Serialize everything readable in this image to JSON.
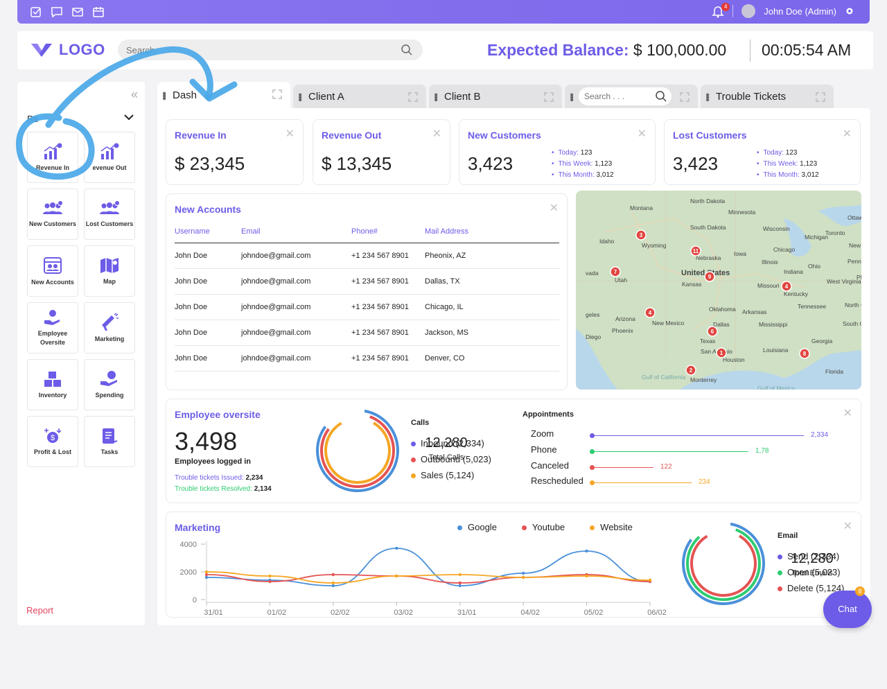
{
  "topbar": {
    "icons": [
      "checkbox-icon",
      "chat-icon",
      "mail-icon",
      "calendar-icon"
    ],
    "notification_count": "4",
    "user": "John Doe (Admin)"
  },
  "header": {
    "logo": "LOGO",
    "search_placeholder": "Search",
    "balance_label": "Expected Balance:",
    "balance_value": "$ 100,000.00",
    "clock": "00:05:54 AM"
  },
  "sidebar": {
    "section": "Re",
    "tiles": [
      {
        "label": "Revenue In",
        "icon": "revenue-in-icon"
      },
      {
        "label": "evenue Out",
        "icon": "revenue-out-icon"
      },
      {
        "label": "New Customers",
        "icon": "new-customers-icon"
      },
      {
        "label": "Lost Customers",
        "icon": "lost-customers-icon"
      },
      {
        "label": "New Accounts",
        "icon": "new-accounts-icon"
      },
      {
        "label": "Map",
        "icon": "map-icon"
      },
      {
        "label": "Employee Oversite",
        "icon": "employee-oversite-icon"
      },
      {
        "label": "Marketing",
        "icon": "marketing-icon"
      },
      {
        "label": "Inventory",
        "icon": "inventory-icon"
      },
      {
        "label": "Spending",
        "icon": "spending-icon"
      },
      {
        "label": "Profit & Lost",
        "icon": "profit-lost-icon"
      },
      {
        "label": "Tasks",
        "icon": "tasks-icon"
      }
    ],
    "report": "Report"
  },
  "tabs": [
    {
      "label": "Dash"
    },
    {
      "label": "Client A"
    },
    {
      "label": "Client B"
    },
    {
      "label": "",
      "placeholder": "Search . . ."
    },
    {
      "label": "Trouble Tickets"
    }
  ],
  "kpis": [
    {
      "title": "Revenue In",
      "value": "$ 23,345"
    },
    {
      "title": "Revenue Out",
      "value": "$ 13,345"
    },
    {
      "title": "New Customers",
      "value": "3,423",
      "stats": [
        [
          "Today:",
          "123"
        ],
        [
          "This Week:",
          "1,123"
        ],
        [
          "This Month:",
          "3,012"
        ]
      ]
    },
    {
      "title": "Lost Customers",
      "value": "3,423",
      "stats": [
        [
          "Today:",
          "123"
        ],
        [
          "This Week:",
          "1,123"
        ],
        [
          "This Month:",
          "3,012"
        ]
      ]
    }
  ],
  "accounts": {
    "title": "New Accounts",
    "columns": [
      "Username",
      "Email",
      "Phone#",
      "Mail Address"
    ],
    "rows": [
      [
        "John Doe",
        "johndoe@gmail.com",
        "+1 234 567 8901",
        "Pheonix, AZ"
      ],
      [
        "John Doe",
        "johndoe@gmail.com",
        "+1 234 567 8901",
        "Dallas, TX"
      ],
      [
        "John Doe",
        "johndoe@gmail.com",
        "+1 234 567 8901",
        "Chicago, IL"
      ],
      [
        "John Doe",
        "johndoe@gmail.com",
        "+1 234 567 8901",
        "Jackson, MS"
      ],
      [
        "John Doe",
        "johndoe@gmail.com",
        "+1 234 567 8901",
        "Denver, CO"
      ]
    ]
  },
  "map": {
    "state_labels": [
      "Montana",
      "North Dakota",
      "Minnesota",
      "South Dakota",
      "Wisconsin",
      "Michigan",
      "Ottawa",
      "Toronto",
      "New York",
      "Idaho",
      "Wyoming",
      "Nebraska",
      "Iowa",
      "Chicago",
      "Illinois",
      "Ohio",
      "Pennsylvania",
      "Philadel",
      "vada",
      "Utah",
      "United States",
      "Kansas",
      "Missouri",
      "Indiana",
      "West Virginia",
      "Kentucky",
      "Tennessee",
      "North Carolina",
      "South Carolina",
      "Oklahoma",
      "Arkansas",
      "Mississippi",
      "Georgia",
      "Arizona",
      "New Mexico",
      "Dallas",
      "Texas",
      "Phoenix",
      "geles",
      "Diego",
      "San Antonio",
      "Houston",
      "Louisiana",
      "Florida",
      "Gulf of California",
      "Monterrey",
      "Gulf of Mexico"
    ],
    "markers": [
      "3",
      "11",
      "7",
      "9",
      "4",
      "4",
      "6",
      "1",
      "2",
      "8"
    ]
  },
  "employee": {
    "title": "Employee oversite",
    "value": "3,498",
    "subtitle": "Employees logged in",
    "issued_label": "Trouble tickets Issued:",
    "issued_value": "2,234",
    "resolved_label": "Trouble tickets Resolved:",
    "resolved_value": "2,134",
    "calls_total": "12,280",
    "calls_total_label": "Total Calls",
    "calls_heading": "Calls",
    "calls": [
      {
        "label": "Inbound (2,334)",
        "color": "#6c5ce7"
      },
      {
        "label": "Outbound (5,023)",
        "color": "#e55353"
      },
      {
        "label": "Sales (5,124)",
        "color": "#f5a623"
      }
    ],
    "appointments_heading": "Appointments",
    "appointments": [
      {
        "label": "Zoom",
        "value": "2,334",
        "color": "#6c5ce7",
        "fraction": 1.0
      },
      {
        "label": "Phone",
        "value": "1,78",
        "color": "#2ecc71",
        "fraction": 0.74
      },
      {
        "label": "Canceled",
        "value": "122",
        "color": "#e55353",
        "fraction": 0.29
      },
      {
        "label": "Rescheduled",
        "value": "234",
        "color": "#f5a623",
        "fraction": 0.47
      }
    ]
  },
  "marketing": {
    "title": "Marketing",
    "legend": [
      {
        "name": "Google",
        "color": "#4a90d9"
      },
      {
        "name": "Youtube",
        "color": "#e55353"
      },
      {
        "name": "Website",
        "color": "#f5a623"
      }
    ],
    "email_total": "12,280",
    "email_total_label": "Total Emails",
    "email_heading": "Email",
    "email": [
      {
        "label": "Send (2,334)",
        "color": "#6c5ce7"
      },
      {
        "label": "Open (5,023)",
        "color": "#2ecc71"
      },
      {
        "label": "Delete (5,124)",
        "color": "#e55353"
      }
    ]
  },
  "chart_data": {
    "type": "line",
    "categories": [
      "31/01",
      "01/02",
      "02/02",
      "03/02",
      "31/01",
      "04/02",
      "05/02",
      "06/02"
    ],
    "ylim": [
      0,
      4000
    ],
    "yticks": [
      "0",
      "2000",
      "4000"
    ],
    "series": [
      {
        "name": "Google",
        "color": "#4a90d9",
        "values": [
          1600,
          1400,
          1000,
          3700,
          1000,
          1900,
          3500,
          1300
        ]
      },
      {
        "name": "Youtube",
        "color": "#e55353",
        "values": [
          1800,
          1300,
          1800,
          1700,
          1200,
          1600,
          1800,
          1300
        ]
      },
      {
        "name": "Website",
        "color": "#f5a623",
        "values": [
          2000,
          1700,
          1200,
          1700,
          1800,
          1600,
          1700,
          1400
        ]
      }
    ]
  },
  "chat": {
    "label": "Chat",
    "badge": "8"
  }
}
